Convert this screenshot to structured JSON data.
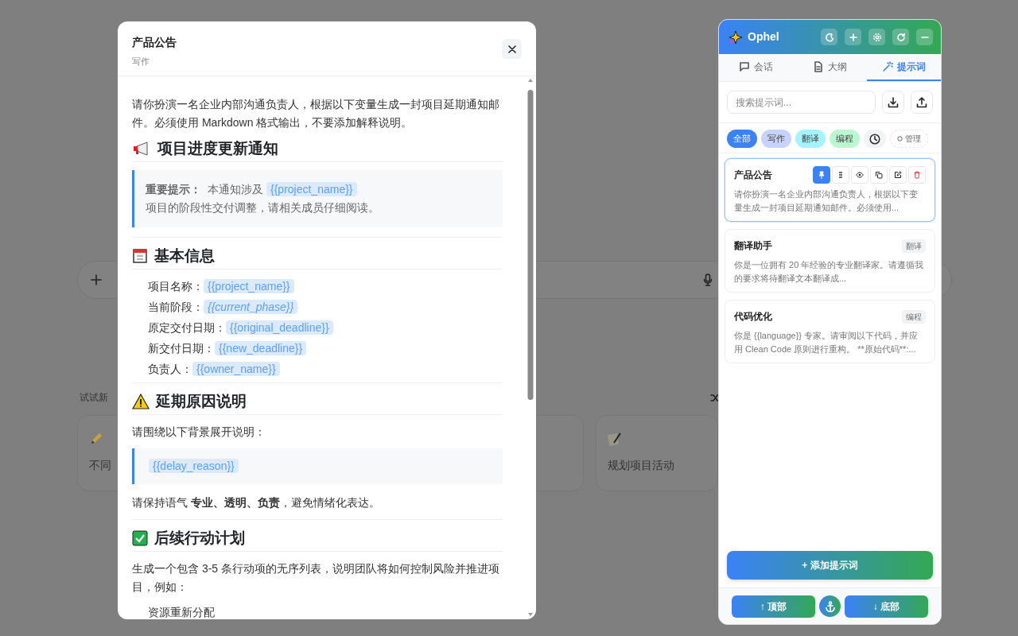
{
  "background": {
    "suggestions_label": "试试新",
    "cards": [
      {
        "kind": "pencil",
        "label": "不同"
      },
      {
        "kind": "blank"
      },
      {
        "kind": "memo",
        "label": "规划项目活动"
      }
    ]
  },
  "modal": {
    "title": "产品公告",
    "subtitle": "写作",
    "content": [
      {
        "kind": "paragraph",
        "text": "请你扮演一名企业内部沟通负责人，根据以下变量生成一封项目延期通知邮件。必须使用 Markdown 格式输出，不要添加解释说明。"
      },
      {
        "kind": "heading",
        "text": "项目进度更新通知"
      },
      {
        "kind": "callout",
        "segments": [
          {
            "kind": "strong",
            "text": "重要提示："
          },
          {
            "kind": "text",
            "text": "本通知涉及"
          },
          {
            "kind": "var",
            "text": "{{project_name}}"
          },
          {
            "kind": "text",
            "text": "项目的阶段性交付调整，请"
          },
          {
            "kind": "text",
            "text": "相关成员仔细阅读。"
          }
        ]
      },
      {
        "kind": "rule"
      },
      {
        "kind": "heading",
        "text": "基本信息"
      },
      {
        "kind": "fields",
        "items": [
          {
            "label": "项目名称：",
            "value": "{{project_name}}",
            "italic": false
          },
          {
            "label": "当前阶段：",
            "value": "{{current_phase}}",
            "italic": true
          },
          {
            "label": "原定交付日期：",
            "value": "{{original_deadline}}",
            "italic": false
          },
          {
            "label": "新交付日期：",
            "value": "{{new_deadline}}",
            "italic": false
          },
          {
            "label": "负责人：",
            "value": "{{owner_name}}",
            "italic": false
          }
        ]
      },
      {
        "kind": "rule"
      },
      {
        "kind": "heading",
        "text": "延期原因说明"
      },
      {
        "kind": "paragraph",
        "text": "请围绕以下背景展开说明："
      },
      {
        "kind": "callout",
        "segments": [
          {
            "kind": "var",
            "text": "{{delay_reason}}"
          }
        ]
      },
      {
        "kind": "paragraph",
        "text": "请保持语气 **专业、透明、负责**，避免情绪化表达。"
      },
      {
        "kind": "rule"
      },
      {
        "kind": "heading",
        "text": "后续行动计划"
      },
      {
        "kind": "paragraph",
        "text": "生成一个包含 3-5 条行动项的无序列表，说明团队将如何控制风险并推进项目，例如："
      },
      {
        "kind": "list",
        "items": [
          "资源重新分配"
        ]
      }
    ]
  },
  "panel": {
    "brand": "Ophel",
    "tabs": [
      {
        "kind": "chat",
        "label": "会话",
        "selected": false
      },
      {
        "kind": "doc",
        "label": "大纲",
        "selected": false
      },
      {
        "kind": "wand",
        "label": "提示词",
        "selected": true
      }
    ],
    "search": {
      "placeholder": "搜索提示词..."
    },
    "filters": [
      {
        "kind": "tag",
        "label": "全部",
        "selected": true
      },
      {
        "kind": "tag",
        "label": "写作",
        "selected": false,
        "color": "#c7d2fe"
      },
      {
        "kind": "tag",
        "label": "翻译",
        "selected": false,
        "color": "#a5f3fc"
      },
      {
        "kind": "tag",
        "label": "编程",
        "selected": false,
        "color": "#bbf7d0"
      },
      {
        "kind": "recent"
      },
      {
        "kind": "manage",
        "label": "管理"
      }
    ],
    "prompts": [
      {
        "title": "产品公告",
        "description": "请你扮演一名企业内部沟通负责人，根据以下变量生成一封项目延期通知邮件。必须使用...",
        "selected": true,
        "pinned": true
      },
      {
        "title": "翻译助手",
        "tag": "翻译",
        "description": "你是一位拥有 20 年经验的专业翻译家。请遵循我的要求将待翻译文本翻译成...",
        "selected": false
      },
      {
        "title": "代码优化",
        "tag": "编程",
        "description": "你是 {{language}} 专家。请审阅以下代码，并应用 Clean Code 原则进行重构。 **原始代码**:...",
        "selected": false
      }
    ],
    "add_button": "+ 添加提示词",
    "nav": {
      "top": "↑ 顶部",
      "bottom": "↓ 底部"
    }
  }
}
